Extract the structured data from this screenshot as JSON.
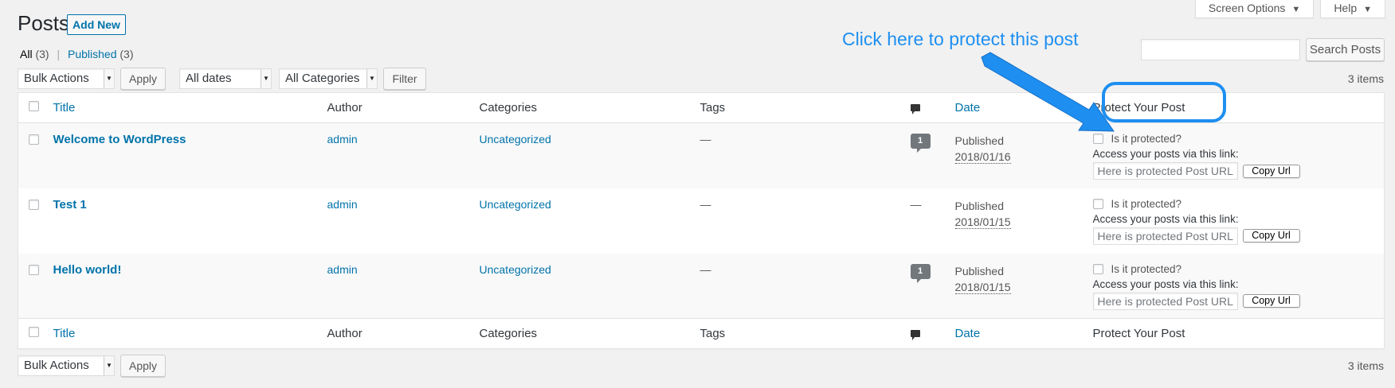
{
  "header": {
    "title": "Posts",
    "add_new": "Add New",
    "screen_options": "Screen Options",
    "help": "Help"
  },
  "filters": {
    "all_label": "All",
    "all_count": "(3)",
    "published_label": "Published",
    "published_count": "(3)"
  },
  "search": {
    "value": "",
    "button": "Search Posts"
  },
  "tablenav_top": {
    "bulk_actions": "Bulk Actions",
    "apply": "Apply",
    "dates": "All dates",
    "categories": "All Categories",
    "filter": "Filter",
    "items": "3 items"
  },
  "tablenav_bottom": {
    "bulk_actions": "Bulk Actions",
    "apply": "Apply",
    "items": "3 items"
  },
  "columns": {
    "title": "Title",
    "author": "Author",
    "categories": "Categories",
    "tags": "Tags",
    "date": "Date",
    "protect": "Protect Your Post"
  },
  "posts": [
    {
      "title": "Welcome to WordPress",
      "author": "admin",
      "category": "Uncategorized",
      "tags": "—",
      "comments": "1",
      "status": "Published",
      "date": "2018/01/16",
      "protect_label": "Is it protected?",
      "access_label": "Access your posts via this link:",
      "url_placeholder": "Here is protected Post URL",
      "copy_button": "Copy Url"
    },
    {
      "title": "Test 1",
      "author": "admin",
      "category": "Uncategorized",
      "tags": "—",
      "comments": "—",
      "status": "Published",
      "date": "2018/01/15",
      "protect_label": "Is it protected?",
      "access_label": "Access your posts via this link:",
      "url_placeholder": "Here is protected Post URL",
      "copy_button": "Copy Url"
    },
    {
      "title": "Hello world!",
      "author": "admin",
      "category": "Uncategorized",
      "tags": "—",
      "comments": "1",
      "status": "Published",
      "date": "2018/01/15",
      "protect_label": "Is it protected?",
      "access_label": "Access your posts via this link:",
      "url_placeholder": "Here is protected Post URL",
      "copy_button": "Copy Url"
    }
  ],
  "annotation": {
    "text": "Click here to protect this post",
    "color": "#1e8ff0"
  },
  "colors": {
    "link": "#0073aa",
    "background": "#f1f1f1"
  },
  "icons": [
    "comment-icon",
    "comment-count-bubble",
    "dropdown-arrow-icon",
    "caret-down-icon"
  ]
}
